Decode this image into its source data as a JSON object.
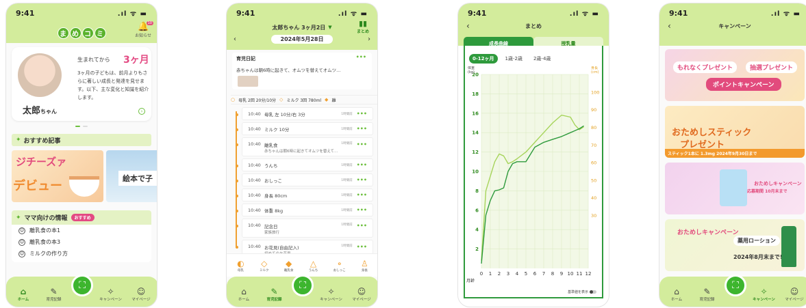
{
  "status": {
    "time": "9:41",
    "icons": ".ıl ᯤ ▬"
  },
  "colors": {
    "header_green": "#d3ec9c",
    "accent_green": "#2e9a3c",
    "pink": "#e34a83",
    "orange": "#f0a030",
    "chart_line_height": "#2e9a3c",
    "chart_line_weight": "#a6d45a"
  },
  "tabs": {
    "home": "ホーム",
    "record": "育児記録",
    "campaign": "キャンペーン",
    "mypage": "マイページ"
  },
  "icons": {
    "home": "home-icon",
    "record": "notebook-icon",
    "camera": "scan-camera-icon",
    "campaign": "party-popper-icon",
    "mypage": "smile-icon",
    "bell": "bell-icon",
    "back": "chevron-left-icon"
  },
  "home": {
    "logo": [
      "ま",
      "め",
      "コ",
      "ミ"
    ],
    "bell_label": "お知らせ",
    "bell_badge": "10",
    "born_label": "生まれてから",
    "age": "3ヶ月",
    "age_description": "3ヶ月の子どもは、前月よりもさらに著しい成長と発達を見せます。以下、主な変化と知識を紹介します。",
    "baby_name": "太郎",
    "baby_suffix": "ちゃん",
    "section_recommend": "おすすめ記事",
    "banner1_line1": "ジチーズァ",
    "banner1_line2": "デビュー",
    "banner2_text": "絵本で子",
    "section_info": "ママ向けの情報",
    "info_pill": "おすすめ",
    "info_items": [
      "離乳食の本1",
      "離乳食の本3",
      "ミルクの作り方"
    ]
  },
  "record": {
    "title": "太郎ちゃん 3ヶ月2日",
    "summary_label": "まとめ",
    "date": "2024年5月28日",
    "diary_title": "育児日記",
    "diary_text": "赤ちゃんは朝6時に起きて、オムツを替えてオムツ...",
    "strip": [
      "母乳 2回 20分/10分",
      "ミルク 3回 780ml",
      "離"
    ],
    "entries": [
      {
        "time": "10:40",
        "label": "母乳 左 10分/右 3分",
        "ago": "1時間前",
        "sub": ""
      },
      {
        "time": "10:40",
        "label": "ミルク 10分",
        "ago": "1時間前",
        "sub": ""
      },
      {
        "time": "10:40",
        "label": "離乳食",
        "ago": "1時間前",
        "sub": "赤ちゃんは朝6時に起きてオムツを替えて..."
      },
      {
        "time": "10:40",
        "label": "うんち",
        "ago": "1時間前",
        "sub": ""
      },
      {
        "time": "10:40",
        "label": "おしっこ",
        "ago": "1時間前",
        "sub": ""
      },
      {
        "time": "10:40",
        "label": "身長 80cm",
        "ago": "1時間前",
        "sub": ""
      },
      {
        "time": "10:40",
        "label": "体重 8kg",
        "ago": "1時間前",
        "sub": ""
      },
      {
        "time": "10:40",
        "label": "記念日",
        "ago": "1時間前",
        "sub": "家族旅行"
      },
      {
        "time": "10:40",
        "label": "お花見(自由記入)",
        "ago": "1時間前",
        "sub": "初めてのお花見"
      }
    ],
    "quick": [
      "母乳",
      "ミルク",
      "離乳食",
      "うんち",
      "おしっこ",
      "身長"
    ]
  },
  "growth": {
    "title": "まとめ",
    "tab_growth": "成長曲線",
    "tab_milk": "授乳量",
    "ranges": [
      "0-12ヶ月",
      "1歳-2歳",
      "2歳-4歳"
    ],
    "show_standard": "基準値を表示"
  },
  "chart_data": {
    "type": "line",
    "xlabel": "月齢",
    "x": [
      0,
      0.5,
      1,
      1.5,
      2,
      2.5,
      3,
      3.5,
      4,
      5,
      6,
      7,
      8,
      9,
      10,
      10.5,
      11,
      11.5
    ],
    "y_left_label": "体重\n(kg)",
    "y_right_label": "身長\n(cm)",
    "ylim_left": [
      0,
      20
    ],
    "ylim_right": [
      0,
      110
    ],
    "y_left_ticks": [
      2,
      4,
      6,
      8,
      10,
      12,
      14,
      16,
      18,
      20
    ],
    "y_right_ticks": [
      30,
      40,
      50,
      60,
      70,
      80,
      90,
      100
    ],
    "x_ticks": [
      0,
      1,
      2,
      3,
      4,
      5,
      6,
      7,
      8,
      9,
      10,
      11,
      12
    ],
    "series": [
      {
        "values": [
          0.8,
          8.0,
          9.5,
          11.0,
          11.8,
          11.6,
          10.8,
          11.0,
          11.3,
          12.0,
          13.0,
          14.0,
          15.0,
          15.8,
          15.6,
          14.8,
          14.3,
          14.6
        ]
      },
      {
        "values": [
          0.5,
          5.5,
          7.0,
          8.0,
          8.1,
          8.3,
          10.0,
          10.8,
          11.0,
          11.0,
          12.5,
          13.0,
          13.3,
          13.6,
          14.0,
          14.2,
          14.4,
          14.7
        ]
      }
    ]
  },
  "campaign": {
    "title": "キャンペーン",
    "c1": [
      "もれなくプレゼント",
      "抽選プレゼント",
      "ポイントキャンペーン"
    ],
    "c2": [
      "おためしスティック",
      "プレゼント",
      "スティック1本に 1.3mg   2024年9月30日まで"
    ],
    "c3": [
      "おためしキャンペーン",
      "応募期間 10月末まで"
    ],
    "c4": [
      "おためしキャンペーン",
      "薬用ローション",
      "2024年8月末まで!"
    ]
  }
}
